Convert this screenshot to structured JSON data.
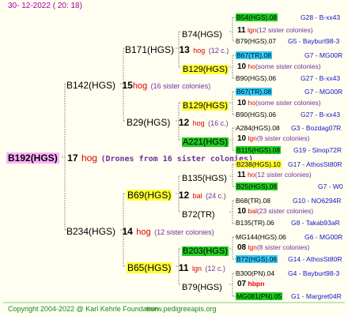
{
  "date": "30- 12-2022 ( 20: 18)",
  "root": {
    "id": "B192(HGS)",
    "num": "17",
    "hog": "hog",
    "note": "(Drones from 16 sister colonies)"
  },
  "gen1": {
    "top": {
      "id": "B142(HGS)",
      "num": "15",
      "hog": "hog",
      "note": "(16 sister colonies)"
    },
    "bottom": {
      "id": "B234(HGS)",
      "num": "14",
      "hog": "hog",
      "note": "(12 sister colonies)"
    }
  },
  "gen2": {
    "a": {
      "id": "B171(HGS)",
      "num": "13",
      "hog": "hog",
      "note": "(12 c.)"
    },
    "b": {
      "id": "B29(HGS)",
      "num": "12",
      "hog": "hog",
      "note": "(16 c.)"
    },
    "c": {
      "id": "B69(HGS)",
      "num": "12",
      "hog": "bal",
      "note": "(24 c.)"
    },
    "d": {
      "id": "B65(HGS)",
      "num": "11",
      "hog": "lgn",
      "note": "(12 c.)"
    }
  },
  "gen3": {
    "a1": {
      "id": "B74(HGS)",
      "num": "11",
      "hog": "lgn",
      "note": "(12 sister colonies)"
    },
    "a2": {
      "id": "B129(HGS)",
      "num": "10",
      "hog": "ho",
      "note": "(some sister colonies)"
    },
    "b1": {
      "id": "B129(HGS)",
      "num": "10",
      "hog": "ho",
      "note": "(some sister colonies)"
    },
    "b2": {
      "id": "A221(HGS)",
      "num": "10",
      "hog": "lgn",
      "note": "(9 sister colonies)"
    },
    "c1": {
      "id": "B135(HGS)",
      "num": "11",
      "hog": "ho",
      "note": "(12 sister colonies)"
    },
    "c2": {
      "id": "B72(TR)",
      "num": "10",
      "hog": "bal",
      "note": "(23 sister colonies)"
    },
    "d1": {
      "id": "B203(HGS)",
      "num": "08",
      "hog": "lgn",
      "note": "(8 sister colonies)"
    },
    "d2": {
      "id": "B79(HGS)",
      "num": "07",
      "hog": "hbpn",
      "note": ""
    }
  },
  "gen4": [
    {
      "id": "B54(HGS).08",
      "right": "G28 - B-xx43"
    },
    {
      "id": "B79(HGS).07",
      "right": "G5 - Bayburt98-3"
    },
    {
      "id": "B67(TR).08",
      "right": "G7 - MG00R"
    },
    {
      "id": "B90(HGS).06",
      "right": "G27 - B-xx43"
    },
    {
      "id": "B67(TR).08",
      "right": "G7 - MG00R"
    },
    {
      "id": "B90(HGS).06",
      "right": "G27 - B-xx43"
    },
    {
      "id": "A284(HGS).08",
      "right": "G3 - Bozdag07R"
    },
    {
      "id": "B115(HGS).08",
      "right": "G19 - Sinop72R"
    },
    {
      "id": "B238(HGS).10",
      "right": "G17 - AthosSt80R"
    },
    {
      "id": "B25(HGS).08",
      "right": "G7 - W0"
    },
    {
      "id": "B68(TR).08",
      "right": "G10 - NO6294R"
    },
    {
      "id": "B135(TR).06",
      "right": "G8 - Takab93aR"
    },
    {
      "id": "MG144(HGS).06",
      "right": "G6 - MG00R"
    },
    {
      "id": "B72(HGS).06",
      "right": "G14 - AthosSt80R"
    },
    {
      "id": "B300(PN).04",
      "right": "G4 - Bayburt98-3"
    },
    {
      "id": "MG081(PN).05",
      "right": "G1 - Margret04R"
    }
  ],
  "footer": {
    "copyright": "Copyright 2004-2022 @ Karl Kehrle Foundation",
    "site": "www.pedigreeapis.org"
  },
  "colors": {
    "yellow": "#ffff33",
    "green": "#22cc22",
    "cyan": "#33ccff",
    "pink": "#ffb0ff"
  }
}
